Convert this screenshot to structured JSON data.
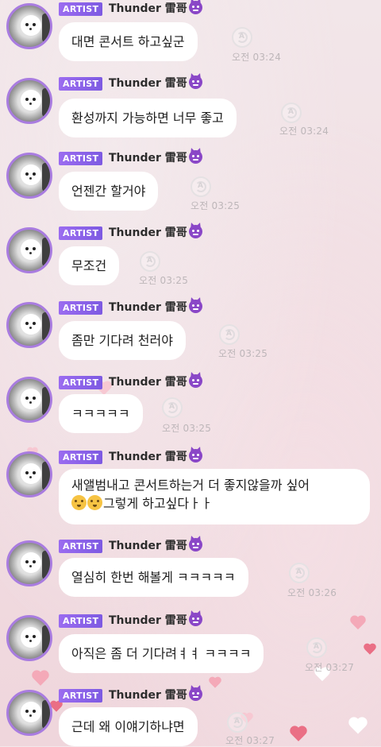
{
  "sender": {
    "badge": "ARTIST",
    "name": "Thunder 雷哥"
  },
  "messages": [
    {
      "text": "대면 콘서트 하고싶군",
      "time": "오전 03:24"
    },
    {
      "text": "환성까지 가능하면 너무 좋고",
      "time": "오전 03:24"
    },
    {
      "text": "언젠간 할거야",
      "time": "오전 03:25"
    },
    {
      "text": "무조건",
      "time": "오전 03:25"
    },
    {
      "text": "좀만 기다려 천러야",
      "time": "오전 03:25"
    },
    {
      "text": "ㅋㅋㅋㅋㅋ",
      "time": "오전 03:25"
    },
    {
      "line1": "새앨범내고 콘서트하는거 더 좋지않을까 싶어",
      "line2": "그렇게 하고싶다ㅏㅏ",
      "time": ""
    },
    {
      "text": "열심히 한번 해볼게 ㅋㅋㅋㅋㅋ",
      "time": "오전 03:26"
    },
    {
      "text": "아직은 좀 더 기다려ㅕㅕ ㅋㅋㅋㅋ",
      "time": "오전 03:27"
    },
    {
      "text": "근데 왜 이얘기하냐면",
      "time": "오전 03:27"
    }
  ]
}
